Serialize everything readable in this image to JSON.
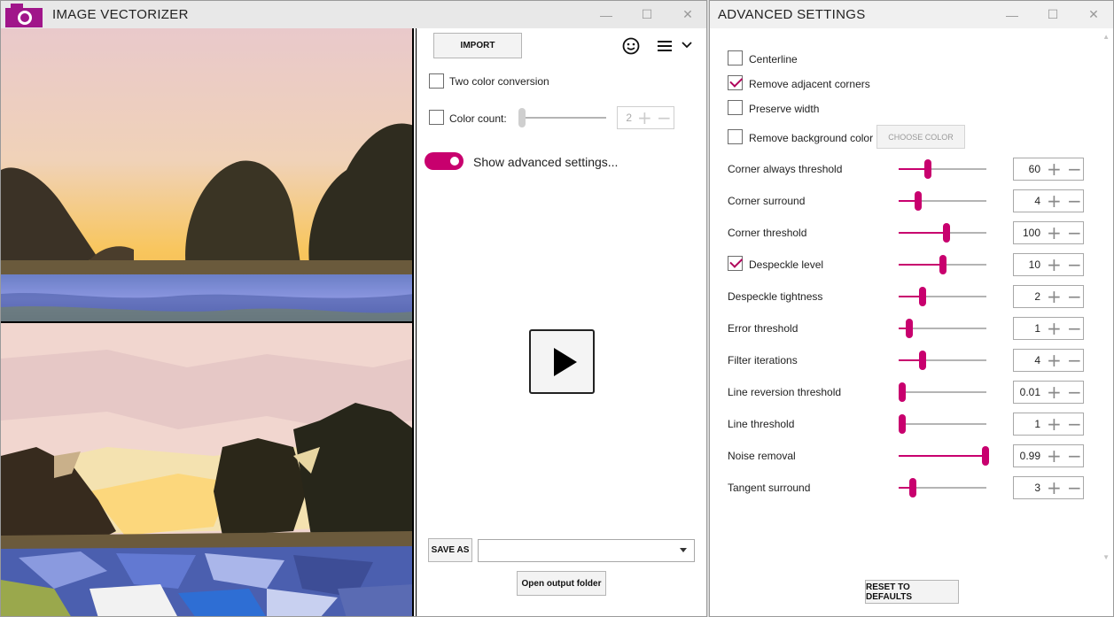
{
  "main_window": {
    "title": "IMAGE VECTORIZER",
    "controls": {
      "minimize": "—",
      "maximize": "☐",
      "close": "✕"
    }
  },
  "controls": {
    "import_label": "IMPORT",
    "two_color": {
      "label": "Two color conversion",
      "checked": false
    },
    "color_count": {
      "label": "Color count:",
      "value": "2",
      "checked": false,
      "level": 0
    },
    "advanced_toggle": {
      "label": "Show advanced settings...",
      "on": true
    },
    "save_as_label": "SAVE AS",
    "save_format_value": "",
    "open_folder_label": "Open output folder"
  },
  "advanced_window": {
    "title": "ADVANCED SETTINGS",
    "controls": {
      "minimize": "—",
      "maximize": "☐",
      "close": "✕"
    },
    "checkboxes": [
      {
        "label": "Centerline",
        "checked": false
      },
      {
        "label": "Remove adjacent corners",
        "checked": true
      },
      {
        "label": "Preserve width",
        "checked": false
      },
      {
        "label": "Remove background color",
        "checked": false
      }
    ],
    "choose_color_label": "CHOOSE COLOR",
    "settings": [
      {
        "label": "Corner always threshold",
        "value": "60",
        "level": 0.33,
        "checkbox": false
      },
      {
        "label": "Corner surround",
        "value": "4",
        "level": 0.22,
        "checkbox": false
      },
      {
        "label": "Corner threshold",
        "value": "100",
        "level": 0.55,
        "checkbox": false
      },
      {
        "label": "Despeckle level",
        "value": "10",
        "level": 0.5,
        "checkbox": true,
        "checked": true
      },
      {
        "label": "Despeckle tightness",
        "value": "2",
        "level": 0.27,
        "checkbox": false
      },
      {
        "label": "Error threshold",
        "value": "1",
        "level": 0.12,
        "checkbox": false
      },
      {
        "label": "Filter iterations",
        "value": "4",
        "level": 0.27,
        "checkbox": false
      },
      {
        "label": "Line reversion threshold",
        "value": "0.01",
        "level": 0.04,
        "checkbox": false
      },
      {
        "label": "Line threshold",
        "value": "1",
        "level": 0.04,
        "checkbox": false
      },
      {
        "label": "Noise removal",
        "value": "0.99",
        "level": 0.99,
        "checkbox": false
      },
      {
        "label": "Tangent surround",
        "value": "3",
        "level": 0.16,
        "checkbox": false
      }
    ],
    "reset_label": "RESET TO DEFAULTS"
  },
  "colors": {
    "accent": "#c8006e",
    "camera": "#a0168a"
  }
}
